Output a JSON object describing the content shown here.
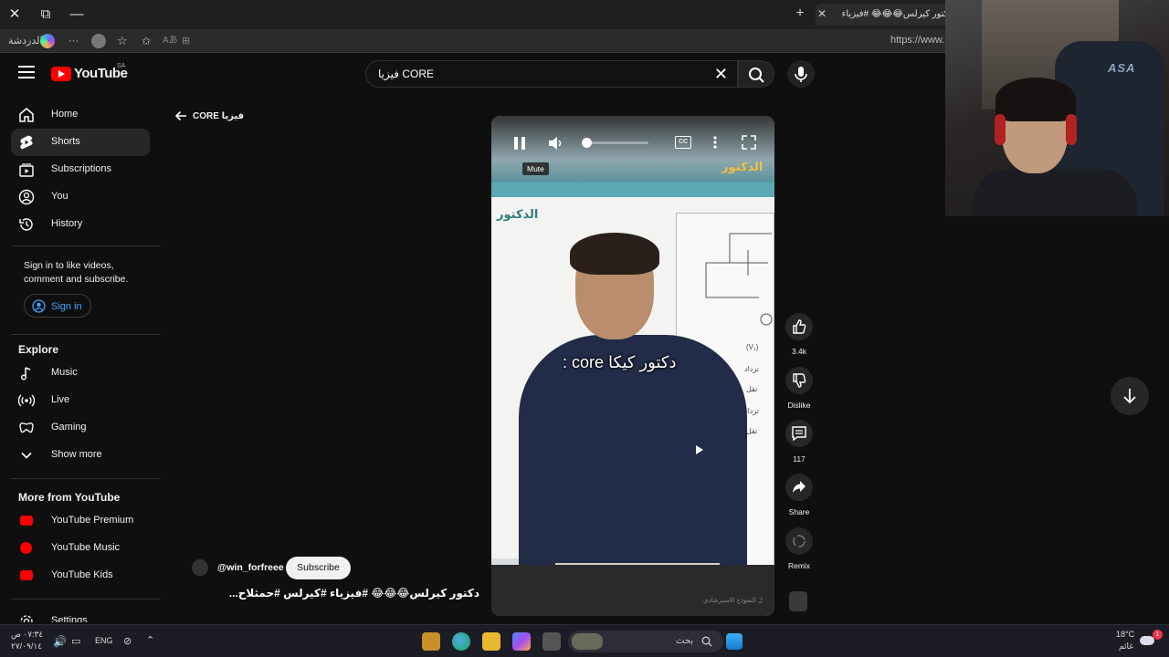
{
  "browser": {
    "tab_title": "دكتور كيرلس😂😂😂 #فيزياء",
    "url": "https://www.",
    "toolbar_chat": "الدردشة",
    "more": "···"
  },
  "youtube": {
    "logo_text": "YouTube",
    "region": "SA",
    "search_query": "فيزيا CORE"
  },
  "sidebar": {
    "items": [
      {
        "label": "Home",
        "icon": "home-icon"
      },
      {
        "label": "Shorts",
        "icon": "shorts-icon"
      },
      {
        "label": "Subscriptions",
        "icon": "subscriptions-icon"
      },
      {
        "label": "You",
        "icon": "you-icon"
      },
      {
        "label": "History",
        "icon": "history-icon"
      }
    ],
    "signin_prompt": "Sign in to like videos, comment and subscribe.",
    "signin_button": "Sign in",
    "explore_title": "Explore",
    "explore_items": [
      {
        "label": "Music",
        "icon": "music-icon"
      },
      {
        "label": "Live",
        "icon": "live-icon"
      },
      {
        "label": "Gaming",
        "icon": "gaming-icon"
      },
      {
        "label": "Show more",
        "icon": "chevron-down-icon"
      }
    ],
    "more_title": "More from YouTube",
    "more_items": [
      {
        "label": "YouTube Premium"
      },
      {
        "label": "YouTube Music"
      },
      {
        "label": "YouTube Kids"
      }
    ],
    "settings_label": "Settings"
  },
  "main": {
    "back_label": "فيزيا CORE",
    "mute_tooltip": "Mute",
    "cc_label": "CC",
    "subtitle": "دكتور كيكا core :",
    "video_logo_top": "الدكتور",
    "video_logo_board": "الدكتور",
    "board_lines": [
      "(V₁)",
      "تزداد",
      "تقل",
      "تزداد",
      "تقل"
    ],
    "bottom_caption": "ل النموذج الاسترشادي",
    "volume_level": 0.05
  },
  "actions": {
    "like_count": "3.4k",
    "dislike_label": "Dislike",
    "comment_count": "117",
    "share_label": "Share",
    "remix_label": "Remix"
  },
  "channel": {
    "handle": "@win_forfreee",
    "subscribe_label": "Subscribe",
    "short_title": "دكتور كيرلس😂😂😂 #فيزياء #كيرلس #حمثلاح..."
  },
  "webcam": {
    "brand": "ASA"
  },
  "taskbar": {
    "time": "٠٧:٣٤ ص",
    "date": "٢٧/٠٩/١٤",
    "lang": "ENG",
    "search_label": "بحث",
    "temperature": "18°C",
    "weather_label": "غائم",
    "notification_count": "1"
  }
}
